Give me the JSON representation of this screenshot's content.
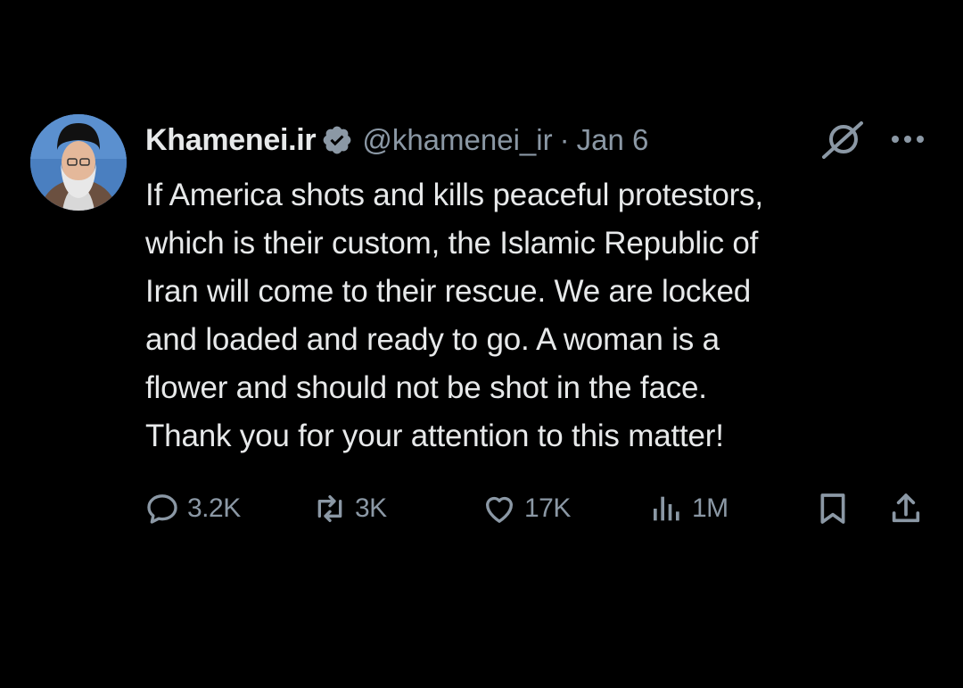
{
  "author": {
    "name": "Khamenei.ir",
    "handle": "@khamenei_ir",
    "separator": "·",
    "date": "Jan 6",
    "avatar_description": "profile photo",
    "verified_color": "#1d9bf0"
  },
  "tweet": {
    "lines": [
      "If America shots and kills peaceful protestors,",
      "which is their custom, the Islamic Republic of",
      "Iran will come to their rescue. We are locked",
      "and loaded and ready to go. A woman is a",
      "flower and should not be shot in the face.",
      "Thank you for your attention to this matter!"
    ]
  },
  "actions": {
    "reply": {
      "icon": "reply-icon",
      "count": "3.2K"
    },
    "retweet": {
      "icon": "retweet-icon",
      "count": "3K"
    },
    "like": {
      "icon": "heart-icon",
      "count": "17K"
    },
    "views": {
      "icon": "views-icon",
      "count": "1M"
    },
    "bookmark": {
      "icon": "bookmark-icon"
    },
    "share": {
      "icon": "share-icon"
    }
  },
  "colors": {
    "background": "#000000",
    "text": "#e7e9ea",
    "muted": "#8b98a5"
  }
}
